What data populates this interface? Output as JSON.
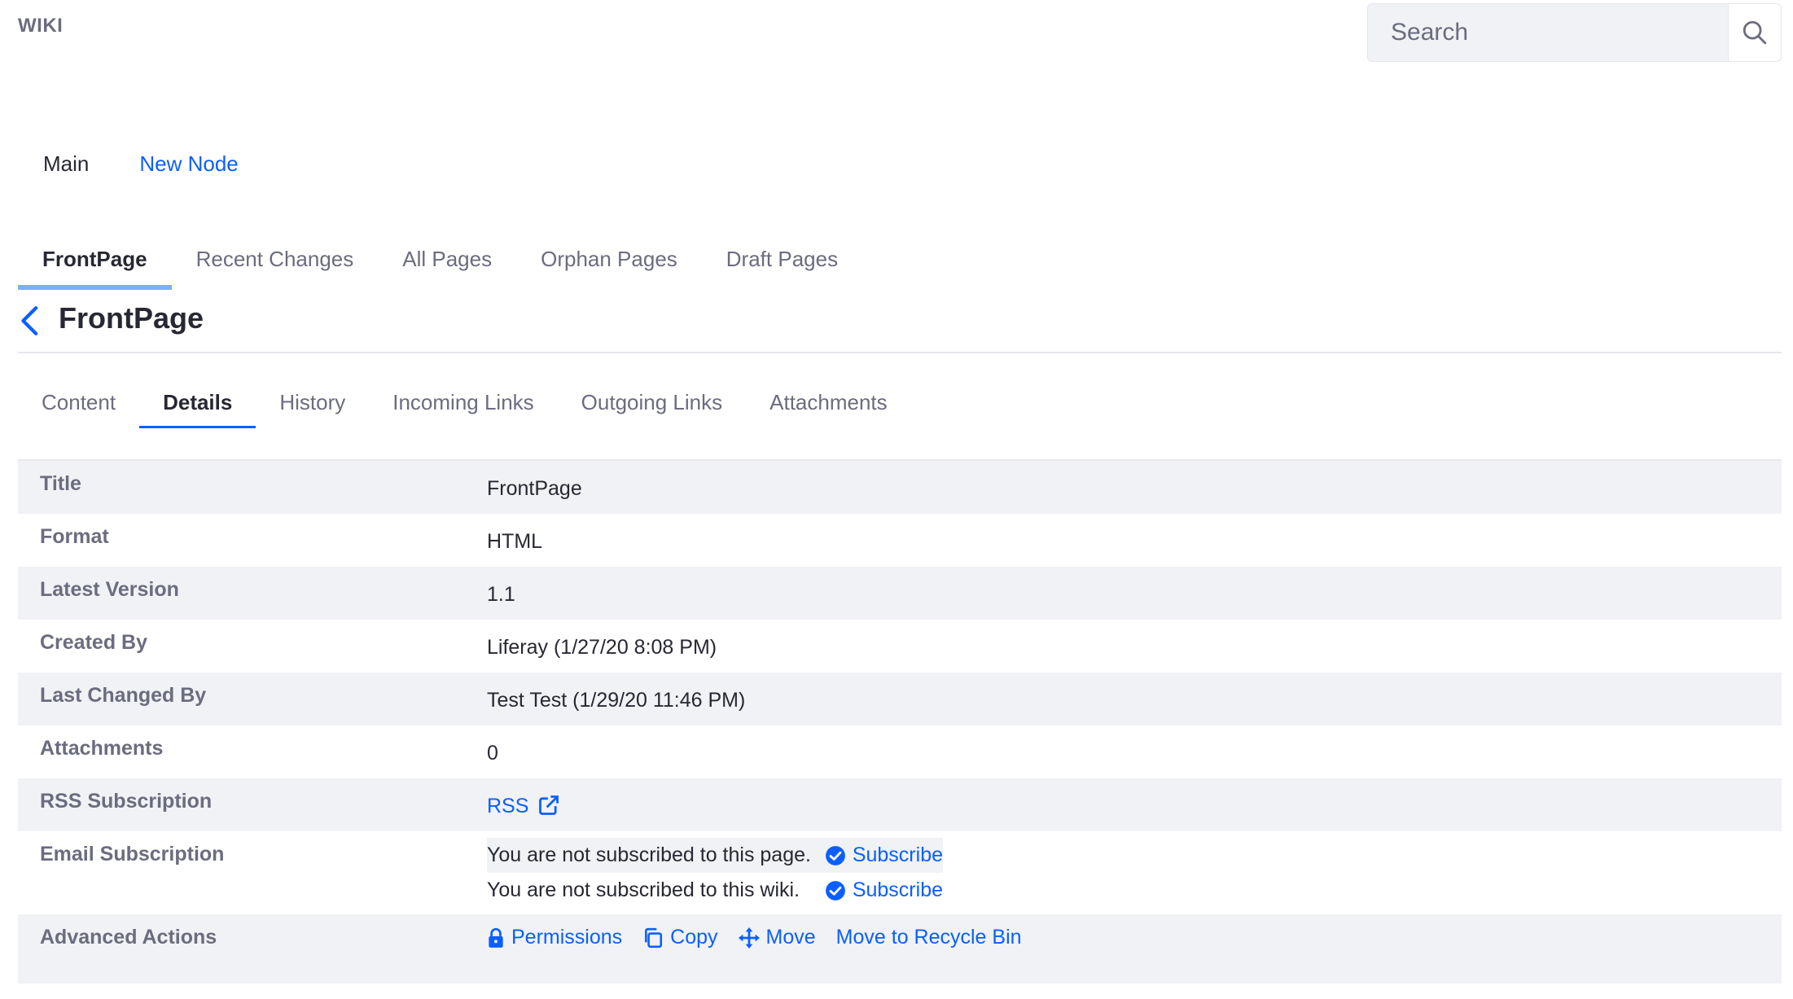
{
  "header": {
    "site_label": "WIKI",
    "search": {
      "placeholder": "Search",
      "value": ""
    }
  },
  "nodes": {
    "main": "Main",
    "new_node": "New Node"
  },
  "main_tabs": [
    "FrontPage",
    "Recent Changes",
    "All Pages",
    "Orphan Pages",
    "Draft Pages"
  ],
  "active_main_tab": "FrontPage",
  "page_title": "FrontPage",
  "sub_tabs": [
    "Content",
    "Details",
    "History",
    "Incoming Links",
    "Outgoing Links",
    "Attachments"
  ],
  "active_sub_tab": "Details",
  "details": {
    "title_label": "Title",
    "title_value": "FrontPage",
    "format_label": "Format",
    "format_value": "HTML",
    "version_label": "Latest Version",
    "version_value": "1.1",
    "created_label": "Created By",
    "created_value": "Liferay (1/27/20 8:08 PM)",
    "changed_label": "Last Changed By",
    "changed_value": "Test Test (1/29/20 11:46 PM)",
    "attachments_label": "Attachments",
    "attachments_value": "0",
    "rss_label": "RSS Subscription",
    "rss_link": "RSS",
    "email_label": "Email Subscription",
    "email_page_text": "You are not subscribed to this page.",
    "email_wiki_text": "You are not subscribed to this wiki.",
    "subscribe_label": "Subscribe",
    "advanced_label": "Advanced Actions",
    "actions": {
      "permissions": "Permissions",
      "copy": "Copy",
      "move": "Move",
      "recycle": "Move to Recycle Bin"
    }
  },
  "colors": {
    "accent": "#0b5fff",
    "tab_indicator": "#80acff",
    "row_shade": "#f1f2f5",
    "muted_text": "#6b6c7e"
  }
}
